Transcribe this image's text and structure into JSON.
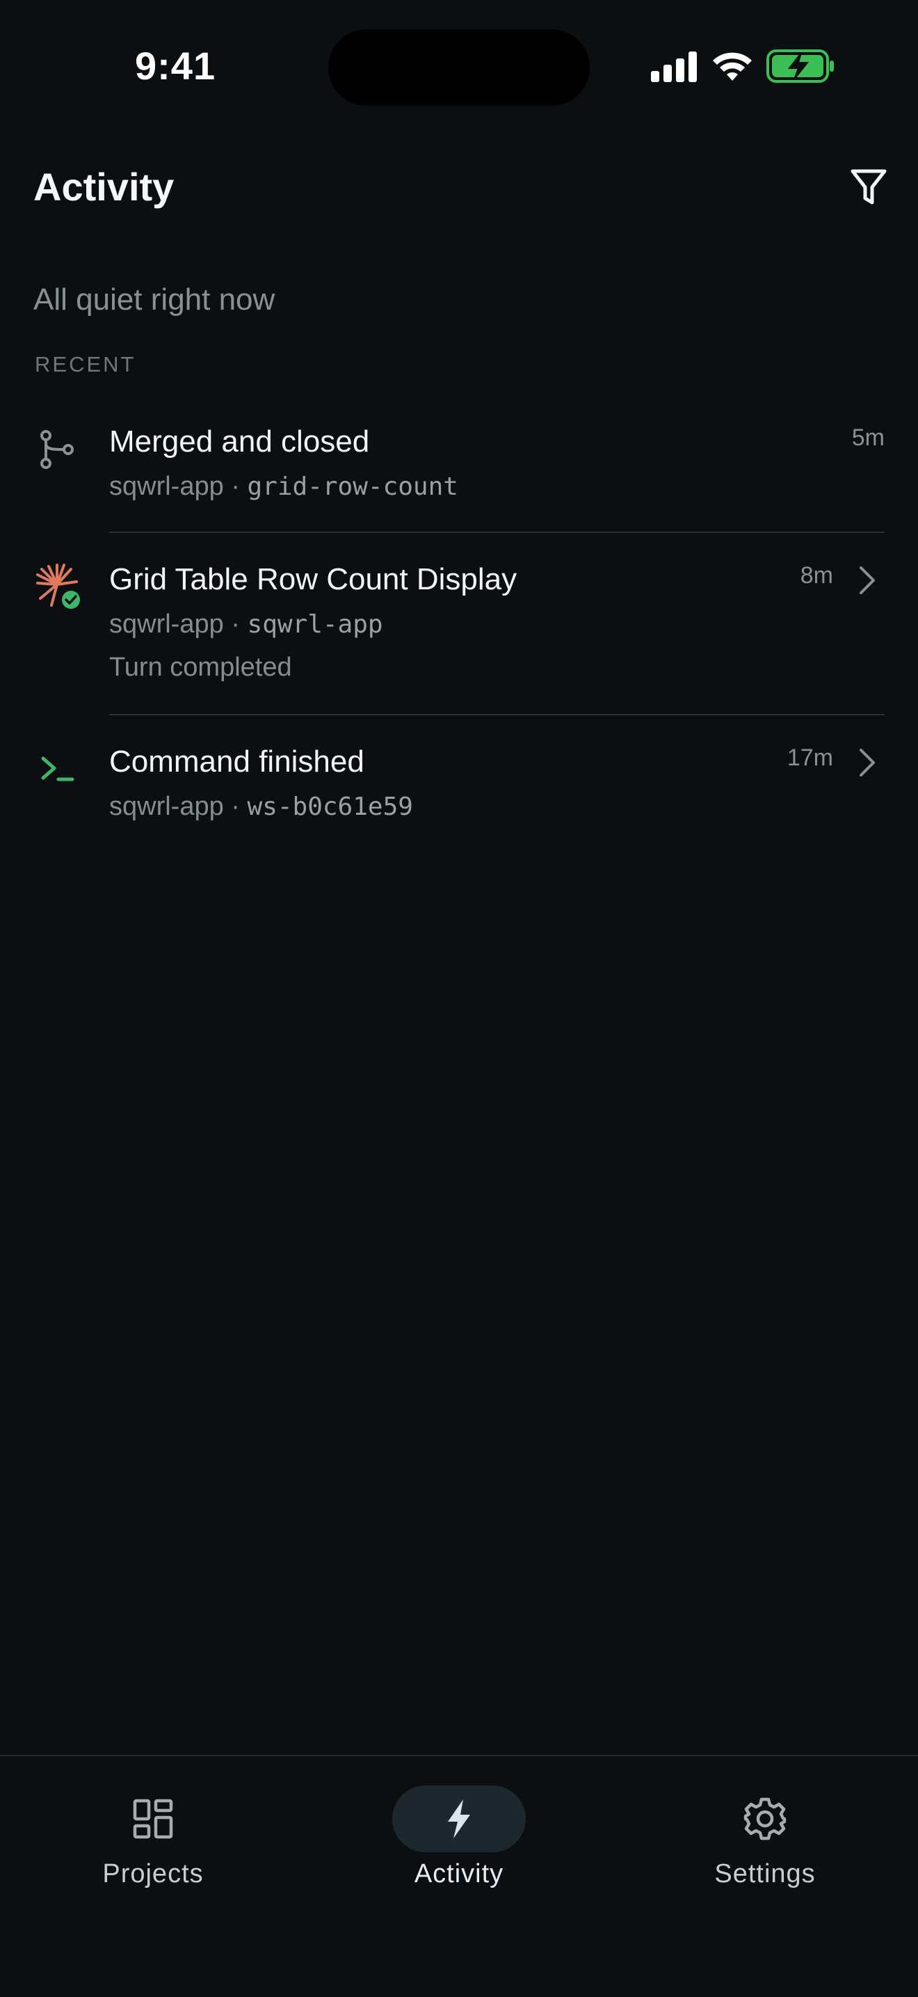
{
  "status_bar": {
    "time": "9:41",
    "icons": [
      "cellular-signal-icon",
      "wifi-icon",
      "battery-charging-icon"
    ],
    "battery_color": "#3bbf55"
  },
  "header": {
    "title": "Activity",
    "filter_icon": "filter-icon"
  },
  "empty_state": "All quiet right now",
  "section_label": "RECENT",
  "activity": [
    {
      "icon": "git-merge-icon",
      "title": "Merged and closed",
      "project": "sqwrl-app",
      "separator": "·",
      "ref": "grid-row-count",
      "extra": "",
      "time": "5m",
      "has_chevron": false
    },
    {
      "icon": "agent-burst-icon",
      "badge": "check-badge-icon",
      "title": "Grid Table Row Count Display",
      "project": "sqwrl-app",
      "separator": "·",
      "ref": "sqwrl-app",
      "extra": "Turn completed",
      "time": "8m",
      "has_chevron": true
    },
    {
      "icon": "terminal-prompt-icon",
      "title": "Command finished",
      "project": "sqwrl-app",
      "separator": "·",
      "ref": "ws-b0c61e59",
      "extra": "",
      "time": "17m",
      "has_chevron": true
    }
  ],
  "tabbar": {
    "tabs": [
      {
        "label": "Projects",
        "icon": "projects-grid-icon",
        "active": false
      },
      {
        "label": "Activity",
        "icon": "bolt-icon",
        "active": true
      },
      {
        "label": "Settings",
        "icon": "gear-icon",
        "active": false
      }
    ]
  },
  "colors": {
    "background": "#0c0f11",
    "accent_agent": "#e07a5f",
    "success": "#3fb56a",
    "terminal": "#3fb56a"
  }
}
